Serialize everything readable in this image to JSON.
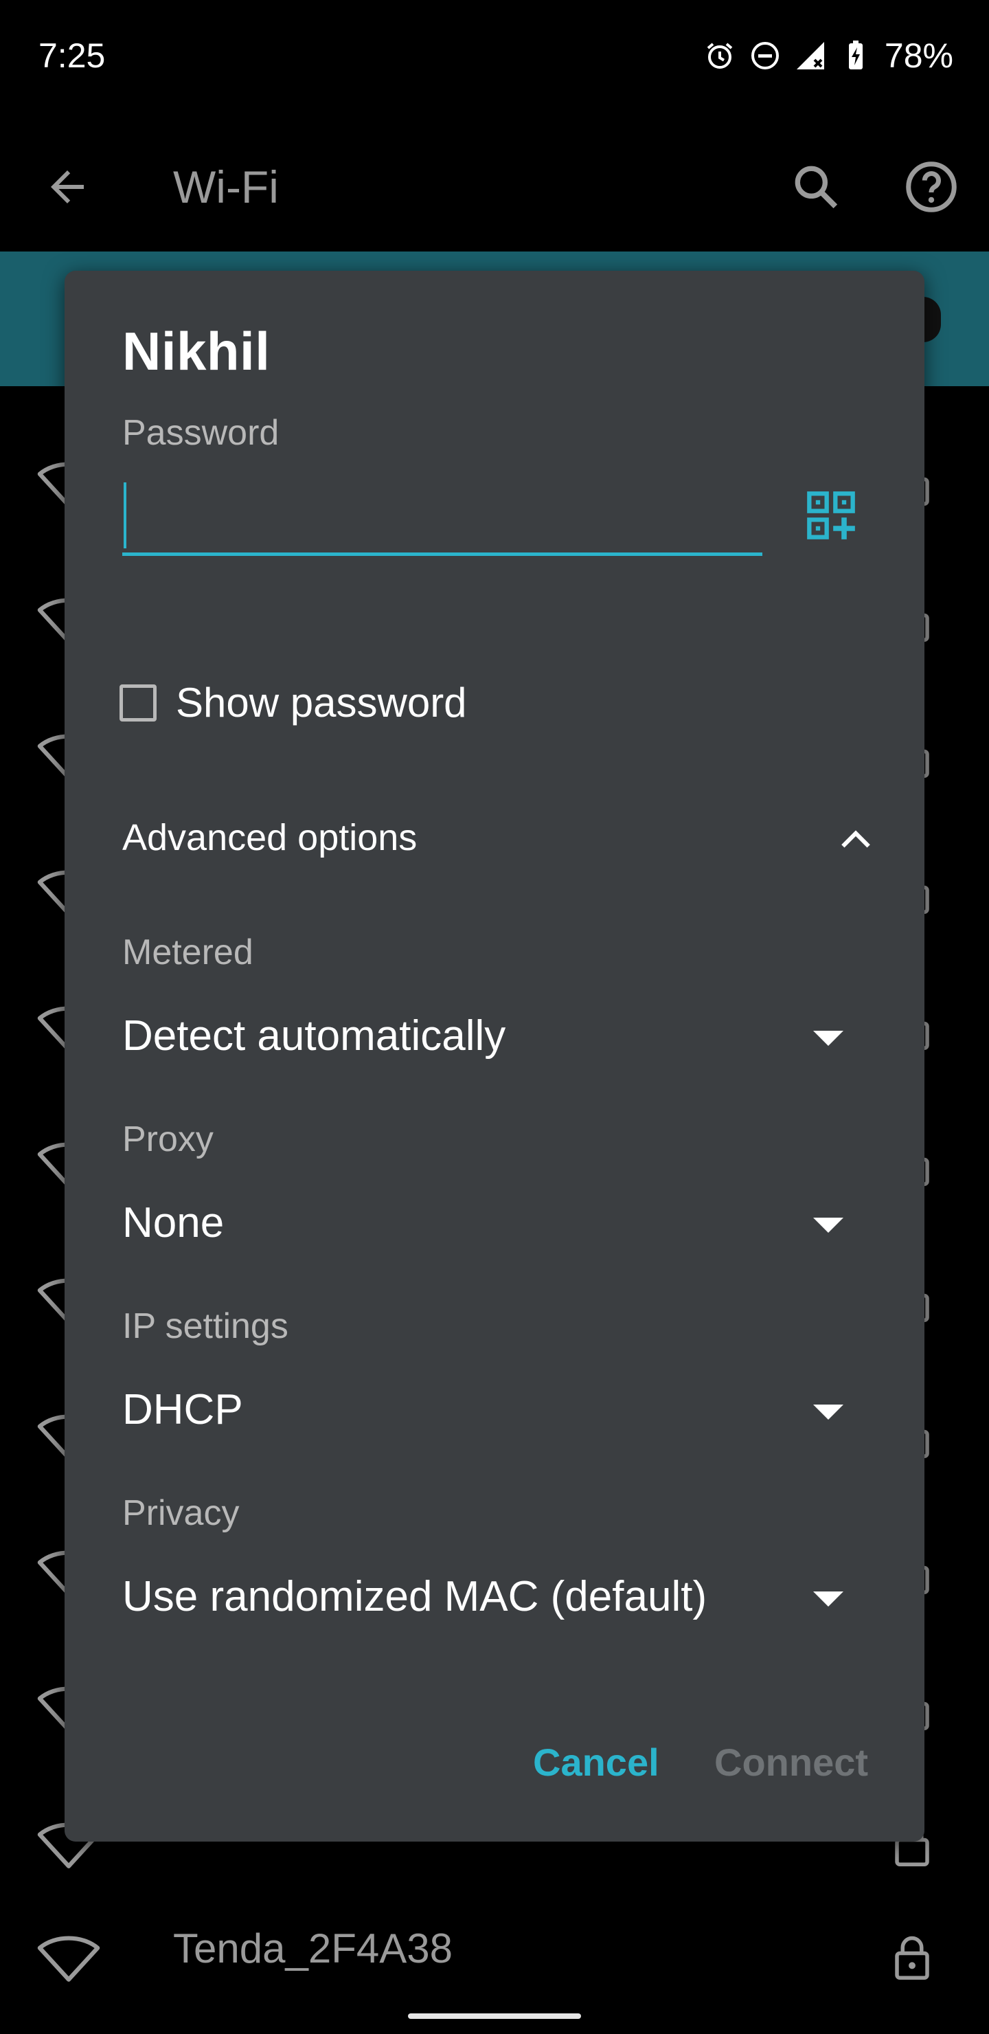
{
  "status_bar": {
    "time": "7:25",
    "battery_percent": "78%",
    "icons": [
      "alarm-icon",
      "do-not-disturb-icon",
      "signal-icon",
      "battery-charging-icon"
    ]
  },
  "app_bar": {
    "title": "Wi-Fi",
    "icons": [
      "back-arrow-icon",
      "search-icon",
      "help-icon"
    ]
  },
  "background_list": {
    "visible_network": "Tenda_2F4A38"
  },
  "dialog": {
    "title": "Nikhil",
    "password_label": "Password",
    "password_value": "",
    "show_password_label": "Show password",
    "show_password_checked": false,
    "advanced_label": "Advanced options",
    "advanced_expanded": true,
    "fields": [
      {
        "label": "Metered",
        "value": "Detect automatically"
      },
      {
        "label": "Proxy",
        "value": "None"
      },
      {
        "label": "IP settings",
        "value": "DHCP"
      },
      {
        "label": "Privacy",
        "value": "Use randomized MAC (default)"
      }
    ],
    "cancel_label": "Cancel",
    "connect_label": "Connect",
    "connect_enabled": false
  },
  "colors": {
    "accent": "#2bb4cc",
    "dialog_bg": "#3b3e41",
    "banner": "#1a5f6b",
    "disabled_text": "#6f7376"
  }
}
